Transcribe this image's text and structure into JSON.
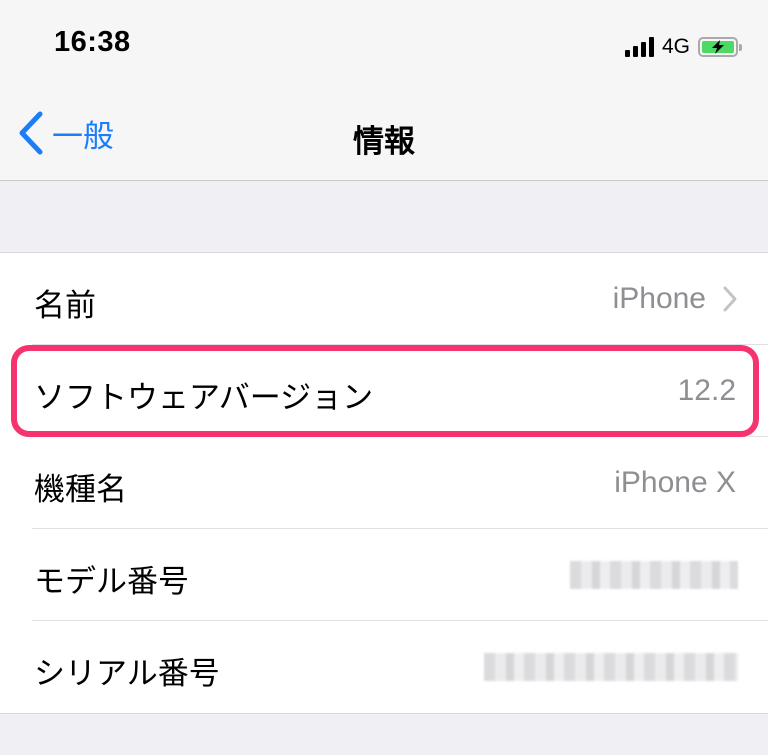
{
  "status_bar": {
    "time": "16:38",
    "network": "4G",
    "signal_icon": "signal-bars-icon",
    "battery_icon": "battery-charging-icon"
  },
  "nav": {
    "back_label": "一般",
    "title": "情報"
  },
  "rows": [
    {
      "label": "名前",
      "value": "iPhone",
      "chevron": true
    },
    {
      "label": "ソフトウェアバージョン",
      "value": "12.2",
      "highlighted": true
    },
    {
      "label": "機種名",
      "value": "iPhone X"
    },
    {
      "label": "モデル番号",
      "value": "",
      "redacted": true
    },
    {
      "label": "シリアル番号",
      "value": "",
      "redacted": true
    }
  ],
  "colors": {
    "accent": "#1b7ef7",
    "highlight": "#f5336e",
    "battery": "#4cd964",
    "secondary_text": "#8e8e93"
  }
}
